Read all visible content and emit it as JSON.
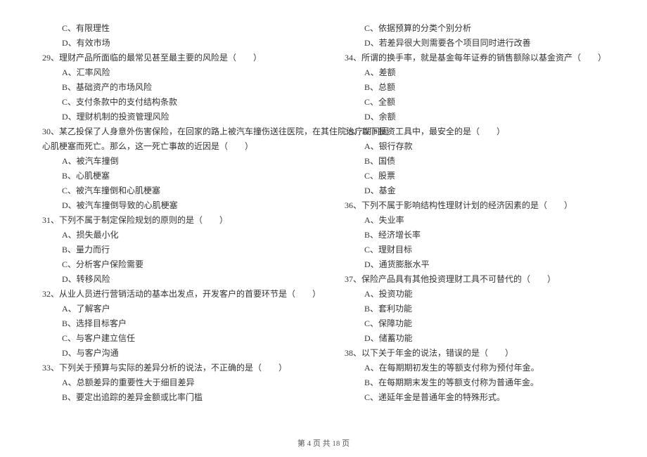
{
  "left": {
    "pre_options": [
      "C、有限理性",
      "D、有效市场"
    ],
    "q29": {
      "stem": "29、理财产品所面临的最常见甚至最主要的风险是（　　）",
      "opts": [
        "A、汇率风险",
        "B、基础资产的市场风险",
        "C、支付条款中的支付结构条款",
        "D、理财机制的投资管理风险"
      ]
    },
    "q30": {
      "stem1": "30、某乙投保了人身意外伤害保险，在回家的路上被汽车撞伤送往医院，在其住院治疗期间因",
      "stem2": "心肌梗塞而死亡。那么，这一死亡事故的近因是（　　）",
      "opts": [
        "A、被汽车撞倒",
        "B、心肌梗塞",
        "C、被汽车撞倒和心肌梗塞",
        "D、被汽车撞倒导致的心肌梗塞"
      ]
    },
    "q31": {
      "stem": "31、下列不属于制定保险规划的原则的是（　　）",
      "opts": [
        "A、损失最小化",
        "B、量力而行",
        "C、分析客户保险需要",
        "D、转移风险"
      ]
    },
    "q32": {
      "stem": "32、从业人员进行营销活动的基本出发点，开发客户的首要环节是（　　）",
      "opts": [
        "A、了解客户",
        "B、选择目标客户",
        "C、与客户建立信任",
        "D、与客户沟通"
      ]
    },
    "q33": {
      "stem": "33、下列关于预算与实际的差异分析的说法，不正确的是（　　）",
      "opts": [
        "A、总额差异的重要性大于细目差异",
        "B、要定出追踪的差异金额或比率门槛"
      ]
    }
  },
  "right": {
    "pre_options": [
      "C、依据预算的分类个别分析",
      "D、若差异很大则需要各个项目同时进行改善"
    ],
    "q34": {
      "stem": "34、所谓的换手率，就是基金每年证券的销售额除以基金资产（　　）",
      "opts": [
        "A、差额",
        "B、总额",
        "C、全额",
        "D、余额"
      ]
    },
    "q35": {
      "stem": "35、以下投资工具中，最安全的是（　　）",
      "opts": [
        "A、银行存款",
        "B、国债",
        "C、股票",
        "D、基金"
      ]
    },
    "q36": {
      "stem": "36、下列不属于影响结构性理财计划的经济因素的是（　　）",
      "opts": [
        "A、失业率",
        "B、经济增长率",
        "C、理财目标",
        "D、通货膨胀水平"
      ]
    },
    "q37": {
      "stem": "37、保险产品具有其他投资理财工具不可替代的（　　）",
      "opts": [
        "A、投资功能",
        "B、套利功能",
        "C、保障功能",
        "D、储蓄功能"
      ]
    },
    "q38": {
      "stem": "38、以下关于年金的说法，错误的是（　　）",
      "opts": [
        "A、在每期期初发生的等额支付称为预付年金。",
        "B、在每期期末发生的等额支付称为普通年金。",
        "C、递延年金是普通年金的特殊形式。"
      ]
    }
  },
  "footer": "第 4 页 共 18 页"
}
